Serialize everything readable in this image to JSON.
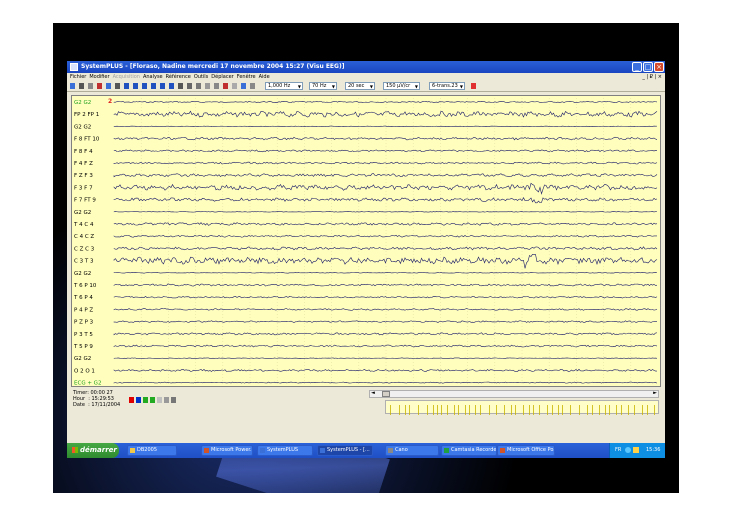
{
  "window": {
    "title": "SystemPLUS - [Floraso, Nadine mercredi 17 novembre 2004 15:27 (Visu EEG)]",
    "mdi_controls": "_ | ₽ | ×"
  },
  "menu": [
    {
      "label": "Fichier",
      "enabled": true
    },
    {
      "label": "Modifier",
      "enabled": true
    },
    {
      "label": "Acquisition",
      "enabled": false
    },
    {
      "label": "Analyse",
      "enabled": true
    },
    {
      "label": "Référence",
      "enabled": true
    },
    {
      "label": "Outils",
      "enabled": true
    },
    {
      "label": "Déplacer",
      "enabled": true
    },
    {
      "label": "Fenêtre",
      "enabled": true
    },
    {
      "label": "Aide",
      "enabled": true
    }
  ],
  "toolbar": {
    "combos": [
      "1,000 Hz",
      "70 Hz",
      "20 sec",
      "150 µV/cr",
      "6-trans.23"
    ]
  },
  "eeg": {
    "marker": "2",
    "channels": [
      {
        "label": "G2 G2",
        "amp": 0.6,
        "color": "#1a1a6a"
      },
      {
        "label": "FP 2 FP 1",
        "amp": 2.6,
        "color": "#1a1a6a"
      },
      {
        "label": "G2 G2",
        "amp": 0.3,
        "color": "#1a1a6a"
      },
      {
        "label": "F 8 FT 10",
        "amp": 1.2,
        "color": "#1a1a6a"
      },
      {
        "label": "F 8 F 4",
        "amp": 0.9,
        "color": "#1a1a6a"
      },
      {
        "label": "F 4 F Z",
        "amp": 0.9,
        "color": "#1a1a6a"
      },
      {
        "label": "F Z F 3",
        "amp": 1.4,
        "color": "#1a1a6a"
      },
      {
        "label": "F 3 F 7",
        "amp": 2.6,
        "color": "#1a1a6a"
      },
      {
        "label": "F 7 FT 9",
        "amp": 1.6,
        "color": "#1a1a6a"
      },
      {
        "label": "G2 G2",
        "amp": 0.3,
        "color": "#1a1a6a"
      },
      {
        "label": "T 4 C 4",
        "amp": 1.2,
        "color": "#1a1a6a"
      },
      {
        "label": "C 4 C Z",
        "amp": 0.9,
        "color": "#1a1a6a"
      },
      {
        "label": "C Z C 3",
        "amp": 1.4,
        "color": "#1a1a6a"
      },
      {
        "label": "C 3 T 3",
        "amp": 3.2,
        "color": "#1a1a6a"
      },
      {
        "label": "G2 G2",
        "amp": 0.3,
        "color": "#1a1a6a"
      },
      {
        "label": "T 6 P 10",
        "amp": 1.0,
        "color": "#1a1a6a"
      },
      {
        "label": "T 6 P 4",
        "amp": 0.8,
        "color": "#1a1a6a"
      },
      {
        "label": "P 4 P Z",
        "amp": 0.8,
        "color": "#1a1a6a"
      },
      {
        "label": "P Z P 3",
        "amp": 0.8,
        "color": "#1a1a6a"
      },
      {
        "label": "P 3 T 5",
        "amp": 1.0,
        "color": "#1a1a6a"
      },
      {
        "label": "T 5 P 9",
        "amp": 0.9,
        "color": "#1a1a6a"
      },
      {
        "label": "G2 G2",
        "amp": 0.3,
        "color": "#1a1a6a"
      },
      {
        "label": "O 2 O 1",
        "amp": 1.0,
        "color": "#1a1a6a"
      },
      {
        "label": "ECG + G2",
        "amp": 0.5,
        "color": "#1a1a6a"
      }
    ],
    "green_labels": [
      0,
      23
    ]
  },
  "status": {
    "timer": "Timer: 00:00 27",
    "hour": "Hour  : 15:29:53",
    "date": "Date  : 17/11/2004"
  },
  "taskbar": {
    "start": "démarrer",
    "tasks": [
      {
        "label": "DB2005",
        "active": false
      },
      {
        "label": "Microsoft Power...",
        "active": false
      },
      {
        "label": "SystemPLUS",
        "active": false
      },
      {
        "label": "SystemPLUS - [...",
        "active": true
      },
      {
        "label": "Cano",
        "active": false
      },
      {
        "label": "Camtasia Recorder",
        "active": false
      },
      {
        "label": "Microsoft Office Po...",
        "active": false
      }
    ],
    "tray_lang": "FR",
    "clock": "15:36"
  },
  "colors": {
    "accent": "#1f4fc4",
    "eeg_background": "#fffebc",
    "trace": "#1a1a6a"
  }
}
